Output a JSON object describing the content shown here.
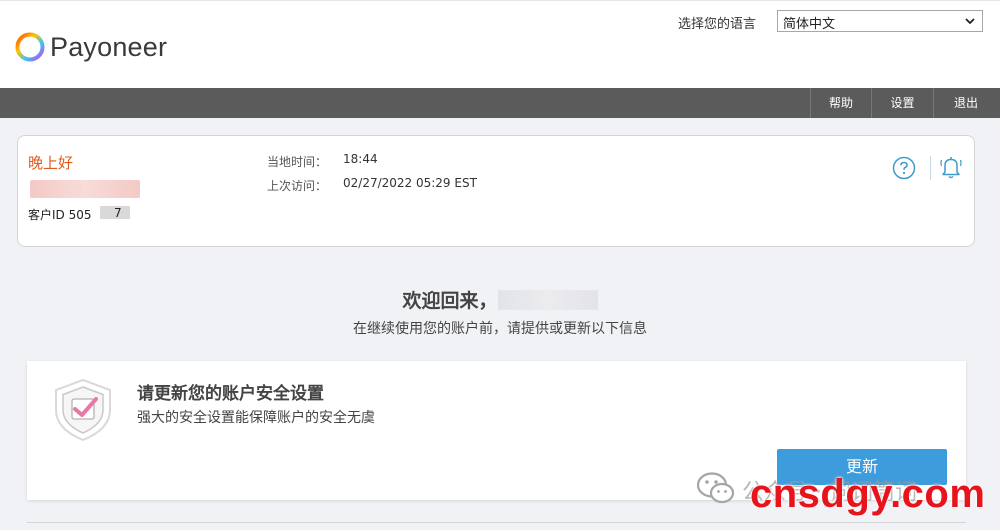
{
  "header": {
    "logo_text": "Payoneer",
    "language_label": "选择您的语言",
    "language_selected": "简体中文"
  },
  "nav": {
    "items": [
      {
        "label": "帮助"
      },
      {
        "label": "设置"
      },
      {
        "label": "退出"
      }
    ]
  },
  "account_card": {
    "greeting": "晚上好",
    "customer_id_label": "客户ID 505",
    "customer_id_suffix": "7",
    "local_time_label": "当地时间：",
    "local_time_value": "18:44",
    "last_visit_label": "上次访问：",
    "last_visit_value": "02/27/2022 05:29 EST"
  },
  "welcome": {
    "title": "欢迎回来，",
    "subtitle": "在继续使用您的账户前，请提供或更新以下信息"
  },
  "security_card": {
    "title": "请更新您的账户安全设置",
    "description": "强大的安全设置能保障账户的安全无虞",
    "button_label": "更新"
  },
  "watermark": {
    "small_text": "公众号 · 词词筒词",
    "big_text": "cnsdgy.com"
  },
  "colors": {
    "nav_bg": "#5b5b5b",
    "greeting": "#e05a1e",
    "accent_blue": "#3d9cdc",
    "watermark_red": "#e8141c"
  }
}
